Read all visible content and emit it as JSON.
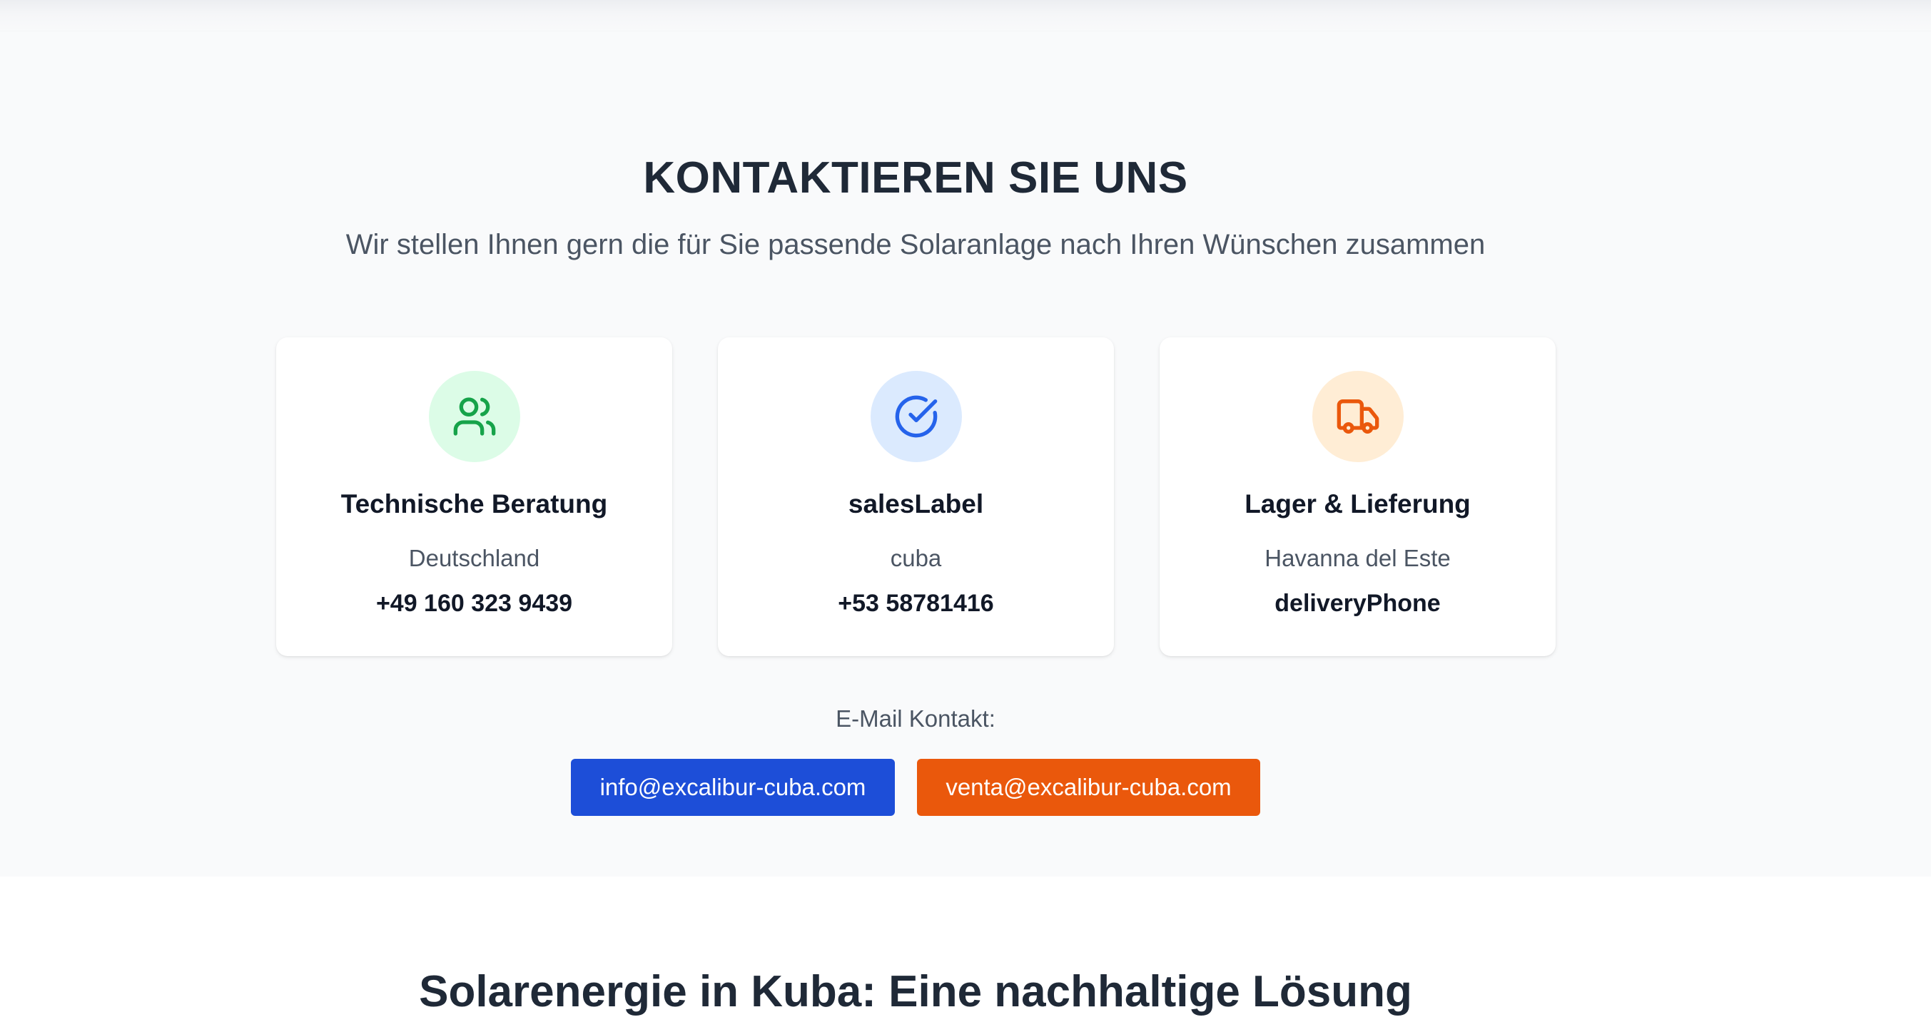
{
  "contact": {
    "title": "KONTAKTIEREN SIE UNS",
    "subtitle": "Wir stellen Ihnen gern die für Sie passende Solaranlage nach Ihren Wünschen zusammen",
    "cards": [
      {
        "icon": "users-icon",
        "accent": "#16a34a",
        "title": "Technische Beratung",
        "location": "Deutschland",
        "phone": "+49 160 323 9439"
      },
      {
        "icon": "check-circle-icon",
        "accent": "#2563eb",
        "title": "salesLabel",
        "location": "cuba",
        "phone": "+53 58781416"
      },
      {
        "icon": "truck-icon",
        "accent": "#ea580c",
        "title": "Lager & Lieferung",
        "location": "Havanna del Este",
        "phone": "deliveryPhone"
      }
    ],
    "email_label": "E-Mail Kontakt:",
    "emails": [
      {
        "address": "info@excalibur-cuba.com",
        "color": "#1d4ed8"
      },
      {
        "address": "venta@excalibur-cuba.com",
        "color": "#ea580c"
      }
    ]
  },
  "solar": {
    "heading": "Solarenergie in Kuba: Eine nachhaltige Lösung"
  }
}
